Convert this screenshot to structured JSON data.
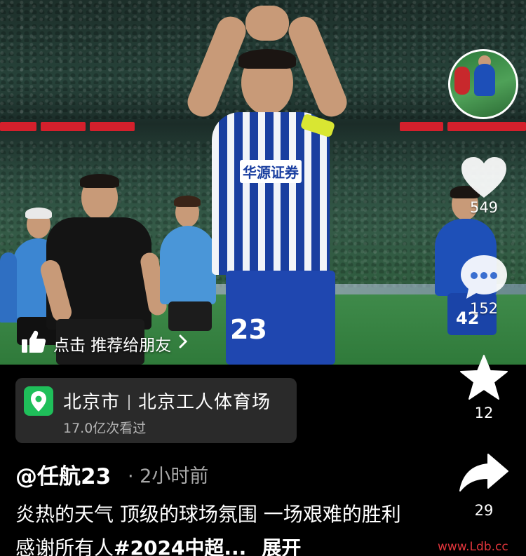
{
  "video": {
    "scene": "stadium-photo",
    "jersey_number_center": "23",
    "jersey_number_right": "42",
    "sponsor_text": "华源证券"
  },
  "actions": {
    "like_count": "549",
    "comment_count": "152",
    "favorite_count": "12",
    "share_count": "29"
  },
  "recommend": {
    "label": "点击 推荐给朋友",
    "icon": "thumbs-up-icon",
    "chevron": "chevron-right-icon"
  },
  "location": {
    "city": "北京市",
    "venue": "北京工人体育场",
    "views": "17.0亿次看过",
    "icon": "map-pin-icon",
    "icon_color": "#1fbf5a"
  },
  "post": {
    "author": "@任航23",
    "time": "· 2小时前",
    "caption_text": "炎热的天气 顶级的球场氛围 一场艰难的胜利 感谢所有人",
    "caption_tag": "#2024中超...",
    "expand_label": "展开"
  },
  "watermark": "www.Ldb.cc",
  "colors": {
    "background": "#000000",
    "card": "#2a2a2a",
    "secondary_text": "#a8a8a8",
    "watermark": "#e0353b"
  }
}
